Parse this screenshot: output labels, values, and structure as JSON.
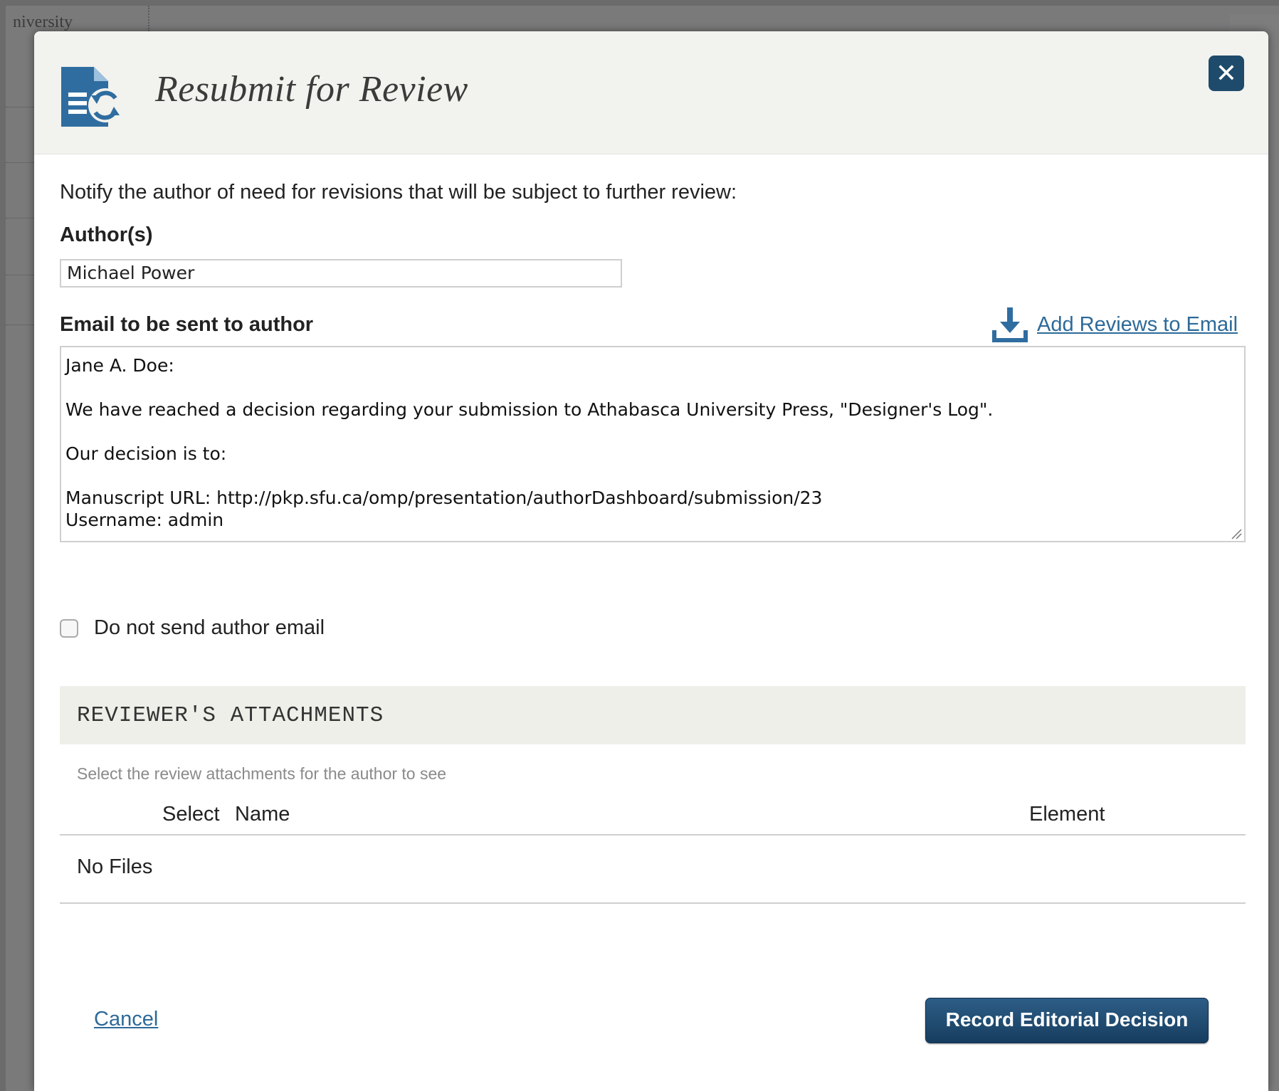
{
  "background": {
    "partial_text": "niversity"
  },
  "dialog": {
    "title": "Resubmit for Review",
    "header_icon": "document-refresh-icon",
    "close_icon": "close-icon",
    "close_symbol": "✕",
    "intro": "Notify the author of need for revisions that will be subject to further review:",
    "authors_label": "Author(s)",
    "authors_value": "Michael Power",
    "email_label": "Email to be sent to author",
    "add_reviews_icon": "download-icon",
    "add_reviews_link": "Add Reviews to Email",
    "email_body": "Jane A. Doe:\n\nWe have reached a decision regarding your submission to Athabasca University Press, \"Designer's Log\".\n\nOur decision is to:\n\nManuscript URL: http://pkp.sfu.ca/omp/presentation/authorDashboard/submission/23\nUsername: admin",
    "do_not_send_label": "Do not send author email",
    "do_not_send_checked": false
  },
  "attachments": {
    "title": "REVIEWER'S ATTACHMENTS",
    "subtitle": "Select the review attachments for the author to see",
    "columns": [
      "Select",
      "Name",
      "Element"
    ],
    "empty_text": "No Files"
  },
  "footer": {
    "cancel": "Cancel",
    "record": "Record Editorial Decision"
  },
  "colors": {
    "accent": "#1e4a6b",
    "link": "#2d6a99",
    "header_bg": "#f2f2ee"
  }
}
